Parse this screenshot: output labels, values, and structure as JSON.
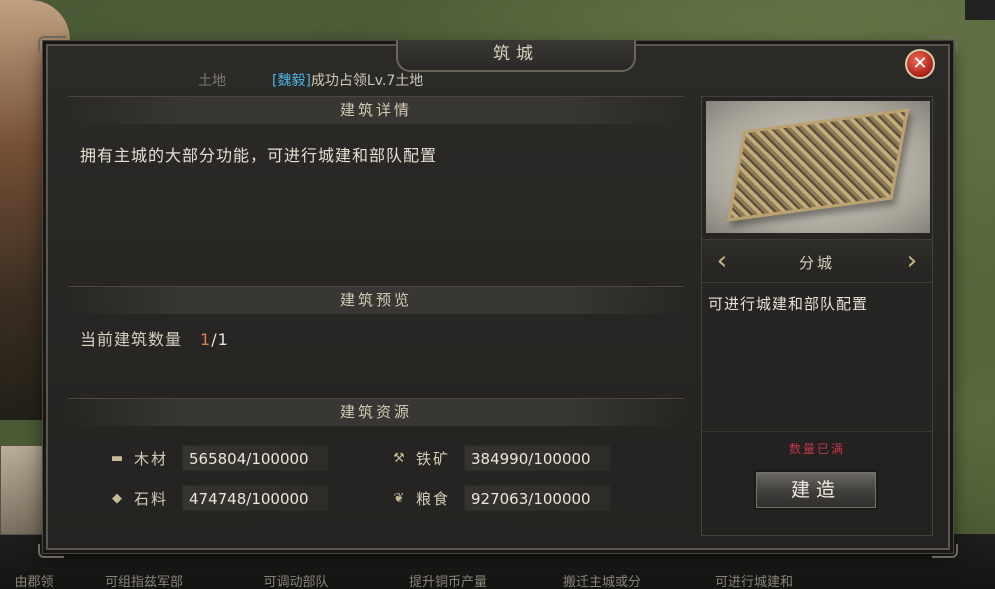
{
  "background": {
    "tabs": [
      "由郡领",
      "可组指兹军部",
      "可调动部队",
      "提升铜币产量",
      "搬迁主城或分",
      "可进行城建和"
    ]
  },
  "dialog": {
    "title": "筑城",
    "close_label": "✕",
    "ticker": {
      "faded": "土地",
      "player": "[魏毅]",
      "message": "成功占领Lv.7土地"
    }
  },
  "details": {
    "heading": "建筑详情",
    "description": "拥有主城的大部分功能，可进行城建和部队配置"
  },
  "preview_section": {
    "heading": "建筑预览",
    "count_label": "当前建筑数量",
    "count_current": "1",
    "count_total": "/1"
  },
  "resources": {
    "heading": "建筑资源",
    "items": [
      {
        "icon": "wood-icon",
        "glyph": "▬",
        "label": "木材",
        "value": "565804/100000"
      },
      {
        "icon": "iron-icon",
        "glyph": "⚒",
        "label": "铁矿",
        "value": "384990/100000"
      },
      {
        "icon": "stone-icon",
        "glyph": "◆",
        "label": "石料",
        "value": "474748/100000"
      },
      {
        "icon": "grain-icon",
        "glyph": "❦",
        "label": "粮食",
        "value": "927063/100000"
      }
    ]
  },
  "building_panel": {
    "arrow_left": "‹",
    "arrow_right": "›",
    "building_name": "分城",
    "building_desc": "可进行城建和部队配置",
    "status_note": "数量已满",
    "build_button": "建造"
  },
  "colors": {
    "accent_name": "#4fb2e6",
    "status_red": "#c0364a",
    "count_orange": "#e07a4a"
  }
}
